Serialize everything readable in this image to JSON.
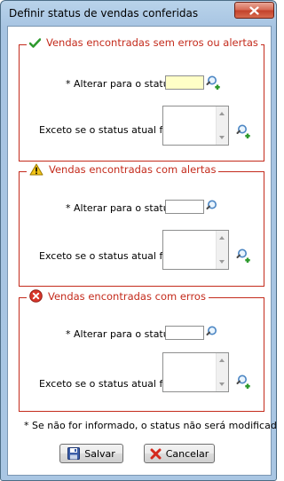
{
  "window": {
    "title": "Definir status de vendas conferidas"
  },
  "groups": [
    {
      "icon": "check-icon",
      "title": "Vendas encontradas sem erros ou alertas",
      "alter_label": "* Alterar para o status",
      "alter_value": "",
      "except_label": "Exceto se o status atual for"
    },
    {
      "icon": "warning-icon",
      "title": "Vendas encontradas com alertas",
      "alter_label": "* Alterar para o status",
      "alter_value": "",
      "except_label": "Exceto se o status atual for"
    },
    {
      "icon": "error-icon",
      "title": "Vendas encontradas com erros",
      "alter_label": "* Alterar para o status",
      "alter_value": "",
      "except_label": "Exceto se o status atual for"
    }
  ],
  "note": "* Se não for informado, o status não será modificado",
  "buttons": {
    "save": "Salvar",
    "cancel": "Cancelar"
  },
  "colors": {
    "accent_red": "#c42b1c",
    "highlight_input": "#ffffc7",
    "check_green": "#2e9a2e",
    "warning_yellow": "#f2c417"
  }
}
